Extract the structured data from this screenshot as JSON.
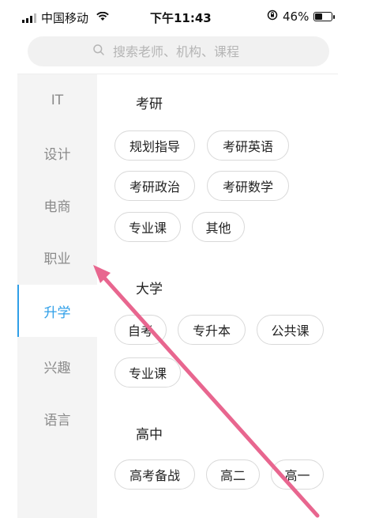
{
  "status_bar": {
    "carrier": "中国移动",
    "time": "下午11:43",
    "battery": "46%",
    "battery_level": 0.46
  },
  "search": {
    "placeholder": "搜索老师、机构、课程"
  },
  "sidebar": {
    "items": [
      {
        "label": "IT",
        "active": false
      },
      {
        "label": "设计",
        "active": false
      },
      {
        "label": "电商",
        "active": false
      },
      {
        "label": "职业",
        "active": false
      },
      {
        "label": "升学",
        "active": true
      },
      {
        "label": "兴趣",
        "active": false
      },
      {
        "label": "语言",
        "active": false
      }
    ]
  },
  "sections": [
    {
      "title": "考研",
      "chips": [
        "规划指导",
        "考研英语",
        "考研政治",
        "考研数学",
        "专业课",
        "其他"
      ]
    },
    {
      "title": "大学",
      "chips": [
        "自考",
        "专升本",
        "公共课",
        "专业课"
      ]
    },
    {
      "title": "高中",
      "chips": [
        "高考备战",
        "高二",
        "高一"
      ]
    }
  ],
  "colors": {
    "accent": "#2f9fe8",
    "annotation_arrow": "#e8668f"
  }
}
